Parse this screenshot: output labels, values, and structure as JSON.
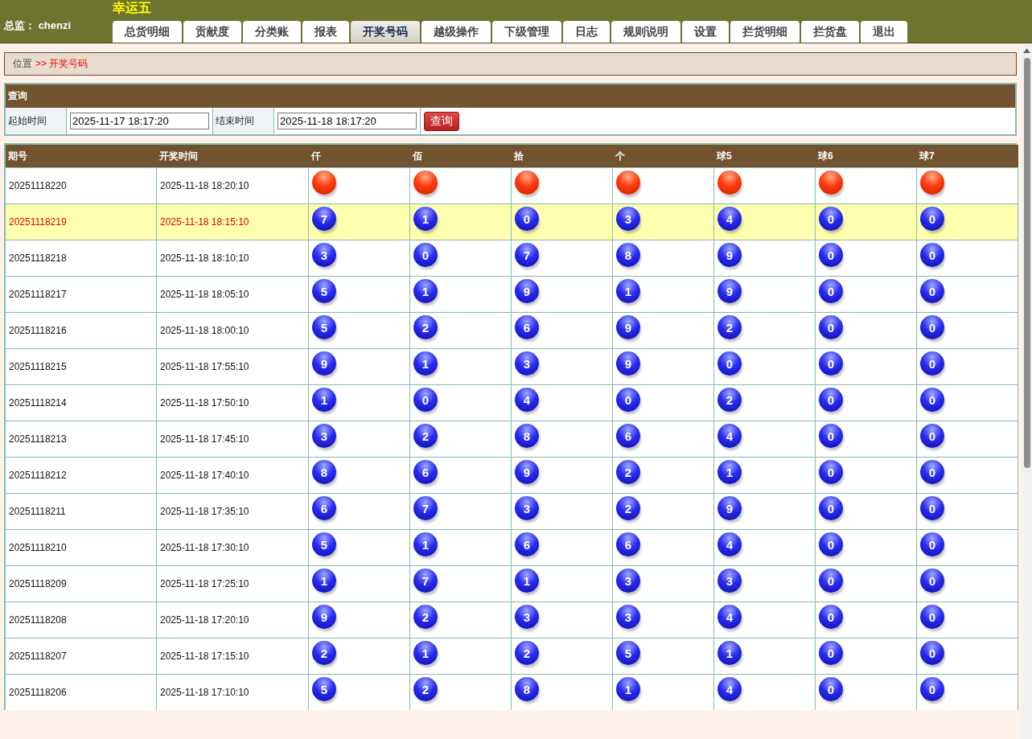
{
  "header": {
    "user_label": "总监：",
    "user_name": "chenzi",
    "title": "幸运五"
  },
  "tabs": [
    {
      "label": "总货明细",
      "selected": false
    },
    {
      "label": "贡献度",
      "selected": false
    },
    {
      "label": "分类账",
      "selected": false
    },
    {
      "label": "报表",
      "selected": false
    },
    {
      "label": "开奖号码",
      "selected": true
    },
    {
      "label": "越级操作",
      "selected": false
    },
    {
      "label": "下级管理",
      "selected": false
    },
    {
      "label": "日志",
      "selected": false
    },
    {
      "label": "规则说明",
      "selected": false
    },
    {
      "label": "设置",
      "selected": false
    },
    {
      "label": "拦货明细",
      "selected": false
    },
    {
      "label": "拦货盘",
      "selected": false
    },
    {
      "label": "退出",
      "selected": false
    }
  ],
  "breadcrumb": {
    "root": "位置",
    "separator": ">>",
    "current": "开奖号码"
  },
  "query": {
    "title": "查询",
    "start_label": "起始时间",
    "start_value": "2025-11-17 18:17:20",
    "end_label": "结束时间",
    "end_value": "2025-11-18 18:17:20",
    "button": "查询"
  },
  "table": {
    "columns": [
      "期号",
      "开奖时间",
      "仟",
      "佰",
      "拾",
      "个",
      "球5",
      "球6",
      "球7"
    ],
    "rows": [
      {
        "period": "20251118220",
        "time": "2025-11-18 18:20:10",
        "highlighted": false,
        "balls": [
          {
            "kind": "pending"
          },
          {
            "kind": "pending"
          },
          {
            "kind": "pending"
          },
          {
            "kind": "pending"
          },
          {
            "kind": "pending"
          },
          {
            "kind": "pending"
          },
          {
            "kind": "pending"
          }
        ]
      },
      {
        "period": "20251118219",
        "time": "2025-11-18 18:15:10",
        "highlighted": true,
        "balls": [
          {
            "kind": "drawn",
            "number": "7"
          },
          {
            "kind": "drawn",
            "number": "1"
          },
          {
            "kind": "drawn",
            "number": "0"
          },
          {
            "kind": "drawn",
            "number": "3"
          },
          {
            "kind": "drawn",
            "number": "4"
          },
          {
            "kind": "drawn",
            "number": "0"
          },
          {
            "kind": "drawn",
            "number": "0"
          }
        ]
      },
      {
        "period": "20251118218",
        "time": "2025-11-18 18:10:10",
        "highlighted": false,
        "balls": [
          {
            "kind": "drawn",
            "number": "3"
          },
          {
            "kind": "drawn",
            "number": "0"
          },
          {
            "kind": "drawn",
            "number": "7"
          },
          {
            "kind": "drawn",
            "number": "8"
          },
          {
            "kind": "drawn",
            "number": "9"
          },
          {
            "kind": "drawn",
            "number": "0"
          },
          {
            "kind": "drawn",
            "number": "0"
          }
        ]
      },
      {
        "period": "20251118217",
        "time": "2025-11-18 18:05:10",
        "highlighted": false,
        "balls": [
          {
            "kind": "drawn",
            "number": "5"
          },
          {
            "kind": "drawn",
            "number": "1"
          },
          {
            "kind": "drawn",
            "number": "9"
          },
          {
            "kind": "drawn",
            "number": "1"
          },
          {
            "kind": "drawn",
            "number": "9"
          },
          {
            "kind": "drawn",
            "number": "0"
          },
          {
            "kind": "drawn",
            "number": "0"
          }
        ]
      },
      {
        "period": "20251118216",
        "time": "2025-11-18 18:00:10",
        "highlighted": false,
        "balls": [
          {
            "kind": "drawn",
            "number": "5"
          },
          {
            "kind": "drawn",
            "number": "2"
          },
          {
            "kind": "drawn",
            "number": "6"
          },
          {
            "kind": "drawn",
            "number": "9"
          },
          {
            "kind": "drawn",
            "number": "2"
          },
          {
            "kind": "drawn",
            "number": "0"
          },
          {
            "kind": "drawn",
            "number": "0"
          }
        ]
      },
      {
        "period": "20251118215",
        "time": "2025-11-18 17:55:10",
        "highlighted": false,
        "balls": [
          {
            "kind": "drawn",
            "number": "9"
          },
          {
            "kind": "drawn",
            "number": "1"
          },
          {
            "kind": "drawn",
            "number": "3"
          },
          {
            "kind": "drawn",
            "number": "9"
          },
          {
            "kind": "drawn",
            "number": "0"
          },
          {
            "kind": "drawn",
            "number": "0"
          },
          {
            "kind": "drawn",
            "number": "0"
          }
        ]
      },
      {
        "period": "20251118214",
        "time": "2025-11-18 17:50:10",
        "highlighted": false,
        "balls": [
          {
            "kind": "drawn",
            "number": "1"
          },
          {
            "kind": "drawn",
            "number": "0"
          },
          {
            "kind": "drawn",
            "number": "4"
          },
          {
            "kind": "drawn",
            "number": "0"
          },
          {
            "kind": "drawn",
            "number": "2"
          },
          {
            "kind": "drawn",
            "number": "0"
          },
          {
            "kind": "drawn",
            "number": "0"
          }
        ]
      },
      {
        "period": "20251118213",
        "time": "2025-11-18 17:45:10",
        "highlighted": false,
        "balls": [
          {
            "kind": "drawn",
            "number": "3"
          },
          {
            "kind": "drawn",
            "number": "2"
          },
          {
            "kind": "drawn",
            "number": "8"
          },
          {
            "kind": "drawn",
            "number": "6"
          },
          {
            "kind": "drawn",
            "number": "4"
          },
          {
            "kind": "drawn",
            "number": "0"
          },
          {
            "kind": "drawn",
            "number": "0"
          }
        ]
      },
      {
        "period": "20251118212",
        "time": "2025-11-18 17:40:10",
        "highlighted": false,
        "balls": [
          {
            "kind": "drawn",
            "number": "8"
          },
          {
            "kind": "drawn",
            "number": "6"
          },
          {
            "kind": "drawn",
            "number": "9"
          },
          {
            "kind": "drawn",
            "number": "2"
          },
          {
            "kind": "drawn",
            "number": "1"
          },
          {
            "kind": "drawn",
            "number": "0"
          },
          {
            "kind": "drawn",
            "number": "0"
          }
        ]
      },
      {
        "period": "20251118211",
        "time": "2025-11-18 17:35:10",
        "highlighted": false,
        "balls": [
          {
            "kind": "drawn",
            "number": "6"
          },
          {
            "kind": "drawn",
            "number": "7"
          },
          {
            "kind": "drawn",
            "number": "3"
          },
          {
            "kind": "drawn",
            "number": "2"
          },
          {
            "kind": "drawn",
            "number": "9"
          },
          {
            "kind": "drawn",
            "number": "0"
          },
          {
            "kind": "drawn",
            "number": "0"
          }
        ]
      },
      {
        "period": "20251118210",
        "time": "2025-11-18 17:30:10",
        "highlighted": false,
        "balls": [
          {
            "kind": "drawn",
            "number": "5"
          },
          {
            "kind": "drawn",
            "number": "1"
          },
          {
            "kind": "drawn",
            "number": "6"
          },
          {
            "kind": "drawn",
            "number": "6"
          },
          {
            "kind": "drawn",
            "number": "4"
          },
          {
            "kind": "drawn",
            "number": "0"
          },
          {
            "kind": "drawn",
            "number": "0"
          }
        ]
      },
      {
        "period": "20251118209",
        "time": "2025-11-18 17:25:10",
        "highlighted": false,
        "balls": [
          {
            "kind": "drawn",
            "number": "1"
          },
          {
            "kind": "drawn",
            "number": "7"
          },
          {
            "kind": "drawn",
            "number": "1"
          },
          {
            "kind": "drawn",
            "number": "3"
          },
          {
            "kind": "drawn",
            "number": "3"
          },
          {
            "kind": "drawn",
            "number": "0"
          },
          {
            "kind": "drawn",
            "number": "0"
          }
        ]
      },
      {
        "period": "20251118208",
        "time": "2025-11-18 17:20:10",
        "highlighted": false,
        "balls": [
          {
            "kind": "drawn",
            "number": "9"
          },
          {
            "kind": "drawn",
            "number": "2"
          },
          {
            "kind": "drawn",
            "number": "3"
          },
          {
            "kind": "drawn",
            "number": "3"
          },
          {
            "kind": "drawn",
            "number": "4"
          },
          {
            "kind": "drawn",
            "number": "0"
          },
          {
            "kind": "drawn",
            "number": "0"
          }
        ]
      },
      {
        "period": "20251118207",
        "time": "2025-11-18 17:15:10",
        "highlighted": false,
        "balls": [
          {
            "kind": "drawn",
            "number": "2"
          },
          {
            "kind": "drawn",
            "number": "1"
          },
          {
            "kind": "drawn",
            "number": "2"
          },
          {
            "kind": "drawn",
            "number": "5"
          },
          {
            "kind": "drawn",
            "number": "1"
          },
          {
            "kind": "drawn",
            "number": "0"
          },
          {
            "kind": "drawn",
            "number": "0"
          }
        ]
      },
      {
        "period": "20251118206",
        "time": "2025-11-18 17:10:10",
        "highlighted": false,
        "balls": [
          {
            "kind": "drawn",
            "number": "5"
          },
          {
            "kind": "drawn",
            "number": "2"
          },
          {
            "kind": "drawn",
            "number": "8"
          },
          {
            "kind": "drawn",
            "number": "1"
          },
          {
            "kind": "drawn",
            "number": "4"
          },
          {
            "kind": "drawn",
            "number": "0"
          },
          {
            "kind": "drawn",
            "number": "0"
          }
        ]
      }
    ]
  }
}
